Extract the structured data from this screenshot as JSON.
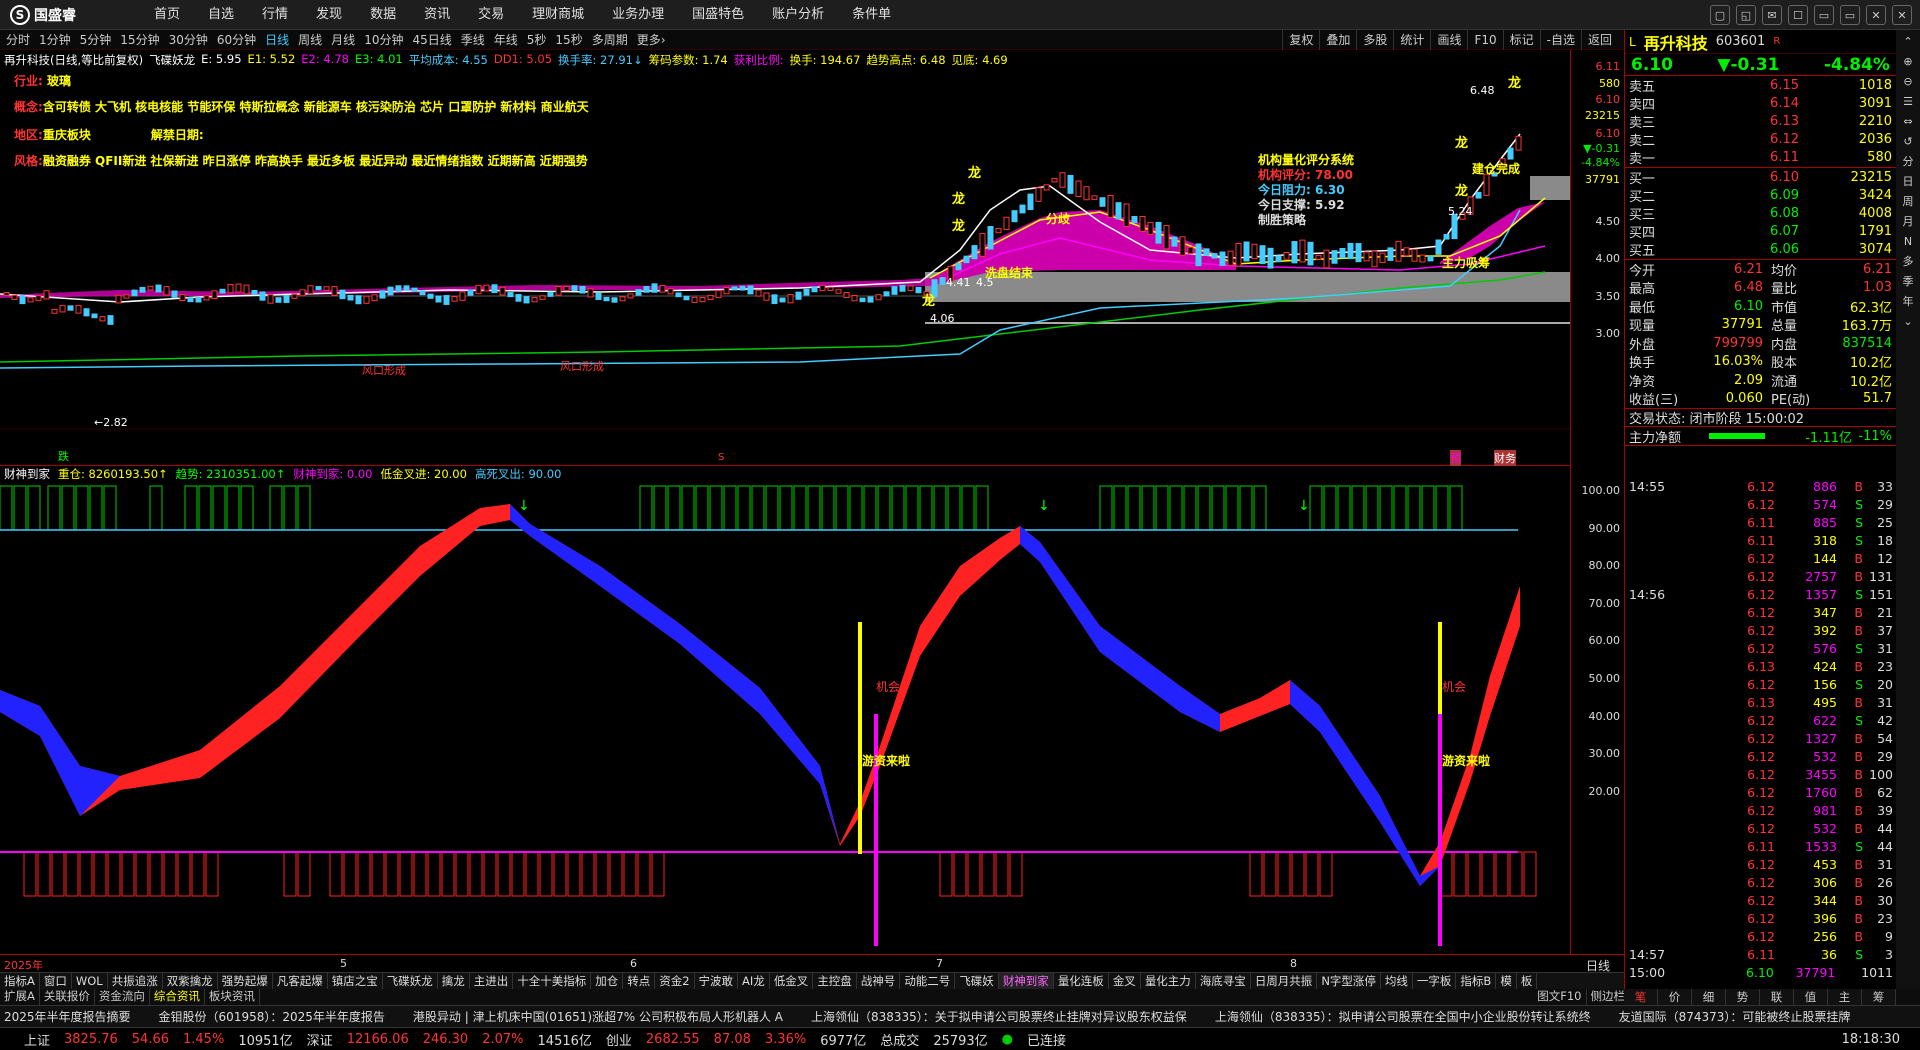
{
  "app": {
    "logo_text": "国盛睿",
    "logo_glyph": "S"
  },
  "menus": [
    "首页",
    "自选",
    "行情",
    "发现",
    "数据",
    "资讯",
    "交易",
    "理财商城",
    "业务办理",
    "国盛特色",
    "账户分析",
    "条件单"
  ],
  "window_controls": [
    "▢",
    "◱",
    "✉",
    "☐",
    "▭",
    "▭",
    "✕",
    "✕"
  ],
  "periods": [
    "分时",
    "1分钟",
    "5分钟",
    "15分钟",
    "30分钟",
    "60分钟",
    "日线",
    "周线",
    "月线",
    "10分钟",
    "45日线",
    "季线",
    "年线",
    "5秒",
    "15秒",
    "多周期",
    "更多›"
  ],
  "active_period": "日线",
  "right_tools": [
    "复权",
    "叠加",
    "多股",
    "统计",
    "画线",
    "F10",
    "标记",
    "-自选",
    "返回"
  ],
  "legend_main": [
    {
      "t": "再升科技(日线,等比前复权)",
      "c": "#fff"
    },
    {
      "t": "飞碟妖龙",
      "c": "#fff"
    },
    {
      "t": "E: 5.95",
      "c": "#fff"
    },
    {
      "t": "E1: 5.52",
      "c": "#ff0"
    },
    {
      "t": "E2: 4.78",
      "c": "#f0f"
    },
    {
      "t": "E3: 4.01",
      "c": "#0f0"
    },
    {
      "t": "平均成本: 4.55",
      "c": "#4cf"
    },
    {
      "t": "DD1: 5.05",
      "c": "#f33"
    },
    {
      "t": "换手率: 27.91↓",
      "c": "#4cf"
    },
    {
      "t": "筹码参数: 1.74",
      "c": "#ff0"
    },
    {
      "t": "获利比例:",
      "c": "#f0f"
    },
    {
      "t": "换手: 194.67",
      "c": "#ff0"
    },
    {
      "t": "趋势高点: 6.48",
      "c": "#ff0"
    },
    {
      "t": "见底: 4.69",
      "c": "#ff0"
    }
  ],
  "info": {
    "industry_k": "行业:",
    "industry_v": "玻璃",
    "concept_k": "概念:",
    "concept_v": "含可转债 大飞机 核电核能 节能环保 特斯拉概念 新能源车 核污染防治 芯片 口罩防护 新材料 商业航天",
    "region_k": "地区:",
    "region_v": "重庆板块",
    "unban_k": "解禁日期:",
    "style_k": "风格:",
    "style_v": "融资融券 QFII新进 社保新进 昨日涨停 昨高换手 最近多板 最近异动 最近情绪指数 近期新高 近期强势"
  },
  "score": {
    "title": "机构量化评分系统",
    "l1": "机构评分: 78.00",
    "l2": "今日阻力: 6.30",
    "l3": "今日支撑: 5.92",
    "l4": "制胜策略"
  },
  "chart_text": {
    "dragon": "龙",
    "xp_end": "洗盘结束",
    "split": "分歧",
    "buy_done": "建仓完成",
    "main_suck": "主力吸筹",
    "low_mark": "←2.82",
    "p648": "6.48",
    "p524": "5.24",
    "p441": "4.41",
    "p45": "4.5",
    "p406": "4.06",
    "fall": "跌",
    "wind1": "风口形成",
    "wind2": "风口形成",
    "s_mark": "S",
    "bottom_tag1": "预",
    "bottom_tag2": "财务",
    "chance": "机会",
    "fund_come": "游资来啦"
  },
  "price_axis": [
    "6.11",
    "580",
    "6.10",
    "23215",
    "6.10",
    "▼-0.31",
    "-4.84%",
    "37791",
    "4.50",
    "4.00",
    "3.50",
    "3.00"
  ],
  "legend_sub": [
    {
      "t": "财神到家",
      "c": "#fff"
    },
    {
      "t": "重仓: 8260193.50↑",
      "c": "#ff0"
    },
    {
      "t": "趋势: 2310351.00↑",
      "c": "#0f0"
    },
    {
      "t": "财神到家: 0.00",
      "c": "#f0f"
    },
    {
      "t": "低金叉进: 20.00",
      "c": "#ff0"
    },
    {
      "t": "高死叉出: 90.00",
      "c": "#4cf"
    }
  ],
  "sub_axis": [
    "100.00",
    "90.00",
    "80.00",
    "70.00",
    "60.00",
    "50.00",
    "40.00",
    "30.00",
    "20.00"
  ],
  "x_axis": [
    "2025年",
    "5",
    "6",
    "7",
    "8"
  ],
  "x_axis_right": "日线",
  "indicators": [
    "指标A",
    "窗口",
    "WOL",
    "共振追涨",
    "双紫擒龙",
    "强势起爆",
    "凡客起爆",
    "镇店之宝",
    "飞碟妖龙",
    "擒龙",
    "主进出",
    "十全十美指标",
    "加仓",
    "转点",
    "资金2",
    "宁波敢",
    "AI龙",
    "低金叉",
    "主控盘",
    "战神号",
    "动能二号",
    "飞碟妖",
    "财神到家",
    "量化连板",
    "金叉",
    "量化主力",
    "海底寻宝",
    "日周月共振",
    "N字型涨停",
    "均线",
    "一字板",
    "指标B",
    "模",
    "板"
  ],
  "active_indicator": "财神到家",
  "tabs": [
    "扩展A",
    "关联报价",
    "资金流向",
    "综合资讯",
    "板块资讯"
  ],
  "tabs_right": [
    "图文F10",
    "侧边栏"
  ],
  "active_tab": "综合资讯",
  "news": [
    "2025年半年度报告摘要",
    "金钼股份（601958）：2025年半年度报告",
    "港股异动 | 津上机床中国(01651)涨超7% 公司积极布局人形机器人 A",
    "上海领仙（838335）：关于拟申请公司股票终止挂牌对异议股东权益保",
    "上海领仙（838335）：拟申请公司股票在全国中小企业股份转让系统终",
    "友道国际（874373）：可能被终止股票挂牌"
  ],
  "status": {
    "sh_k": "上证",
    "sh_v": "3825.76",
    "sh_c": "54.66",
    "sh_p": "1.45%",
    "sh_a": "10951亿",
    "sz_k": "深证",
    "sz_v": "12166.06",
    "sz_c": "246.30",
    "sz_p": "2.07%",
    "sz_a": "14516亿",
    "cy_k": "创业",
    "cy_v": "2682.55",
    "cy_c": "87.08",
    "cy_p": "3.36%",
    "cy_a": "6977亿",
    "total_k": "总成交",
    "total_v": "25793亿",
    "conn": "已连接",
    "time": "18:18:30"
  },
  "quote": {
    "name": "再升科技",
    "code": "603601",
    "flag": "R",
    "mkt": "L",
    "price": "6.10",
    "chg": "▼-0.31",
    "pct": "-4.84%",
    "asks": [
      [
        "卖五",
        "6.15",
        "1018"
      ],
      [
        "卖四",
        "6.14",
        "3091"
      ],
      [
        "卖三",
        "6.13",
        "2210"
      ],
      [
        "卖二",
        "6.12",
        "2036"
      ],
      [
        "卖一",
        "6.11",
        "580"
      ]
    ],
    "bids": [
      [
        "买一",
        "6.10",
        "23215"
      ],
      [
        "买二",
        "6.09",
        "3424"
      ],
      [
        "买三",
        "6.08",
        "4008"
      ],
      [
        "买四",
        "6.07",
        "1791"
      ],
      [
        "买五",
        "6.06",
        "3074"
      ]
    ],
    "stats": [
      [
        "今开",
        "6.21",
        "均价",
        "6.21"
      ],
      [
        "最高",
        "6.48",
        "量比",
        "1.03"
      ],
      [
        "最低",
        "6.10",
        "市值",
        "62.3亿"
      ],
      [
        "现量",
        "37791",
        "总量",
        "163.7万"
      ],
      [
        "外盘",
        "799799",
        "内盘",
        "837514"
      ],
      [
        "换手",
        "16.03%",
        "股本",
        "10.2亿"
      ],
      [
        "净资",
        "2.09",
        "流通",
        "10.2亿"
      ],
      [
        "收益(三)",
        "0.060",
        "PE(动)",
        "51.7"
      ]
    ],
    "trade_state": "交易状态: 闭市阶段 15:00:02",
    "net_k": "主力净额",
    "net_v": "-1.11亿",
    "net_p": "-11%",
    "trades": [
      [
        "14:55",
        "6.12",
        "886",
        "B",
        "33"
      ],
      [
        "",
        "6.12",
        "574",
        "S",
        "29"
      ],
      [
        "",
        "6.11",
        "885",
        "S",
        "25"
      ],
      [
        "",
        "6.11",
        "318",
        "S",
        "18"
      ],
      [
        "",
        "6.12",
        "144",
        "B",
        "12"
      ],
      [
        "",
        "6.12",
        "2757",
        "B",
        "131"
      ],
      [
        "14:56",
        "6.12",
        "1357",
        "S",
        "151"
      ],
      [
        "",
        "6.12",
        "347",
        "B",
        "21"
      ],
      [
        "",
        "6.12",
        "392",
        "B",
        "37"
      ],
      [
        "",
        "6.12",
        "576",
        "S",
        "31"
      ],
      [
        "",
        "6.13",
        "424",
        "B",
        "23"
      ],
      [
        "",
        "6.12",
        "156",
        "S",
        "20"
      ],
      [
        "",
        "6.13",
        "495",
        "B",
        "31"
      ],
      [
        "",
        "6.12",
        "622",
        "S",
        "42"
      ],
      [
        "",
        "6.12",
        "1327",
        "B",
        "54"
      ],
      [
        "",
        "6.12",
        "532",
        "B",
        "29"
      ],
      [
        "",
        "6.12",
        "3455",
        "B",
        "100"
      ],
      [
        "",
        "6.12",
        "1760",
        "B",
        "62"
      ],
      [
        "",
        "6.12",
        "981",
        "B",
        "39"
      ],
      [
        "",
        "6.12",
        "532",
        "B",
        "44"
      ],
      [
        "",
        "6.11",
        "1533",
        "S",
        "44"
      ],
      [
        "",
        "6.12",
        "453",
        "B",
        "31"
      ],
      [
        "",
        "6.12",
        "306",
        "B",
        "26"
      ],
      [
        "",
        "6.12",
        "344",
        "B",
        "30"
      ],
      [
        "",
        "6.12",
        "396",
        "B",
        "23"
      ],
      [
        "",
        "6.12",
        "256",
        "B",
        "9"
      ],
      [
        "14:57",
        "6.11",
        "36",
        "S",
        "3"
      ],
      [
        "15:00",
        "6.10",
        "37791",
        "",
        "1011"
      ]
    ],
    "bottom_tabs": [
      "笔",
      "价",
      "细",
      "势",
      "联",
      "值",
      "主",
      "筹"
    ],
    "active_bottom": "笔"
  },
  "side": [
    "⌃",
    "⊕",
    "⊖",
    "☰",
    "⇔",
    "↺",
    "分",
    "日",
    "周",
    "月",
    "N",
    "多",
    "季",
    "年",
    "⌄"
  ]
}
